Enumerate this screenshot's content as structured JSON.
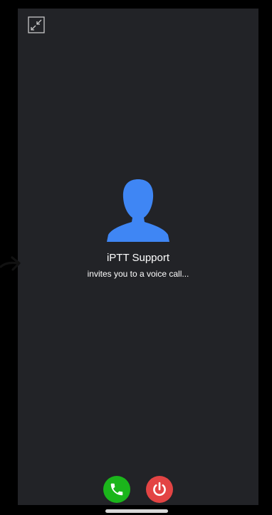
{
  "call": {
    "caller_name": "iPTT Support",
    "subtitle": "invites you to a voice call..."
  },
  "colors": {
    "background": "#222327",
    "avatar": "#3f86f4",
    "accept": "#1bb51b",
    "decline": "#e34444"
  },
  "icons": {
    "minimize": "minimize-icon",
    "avatar": "person-icon",
    "accept": "phone-icon",
    "decline": "power-icon"
  }
}
